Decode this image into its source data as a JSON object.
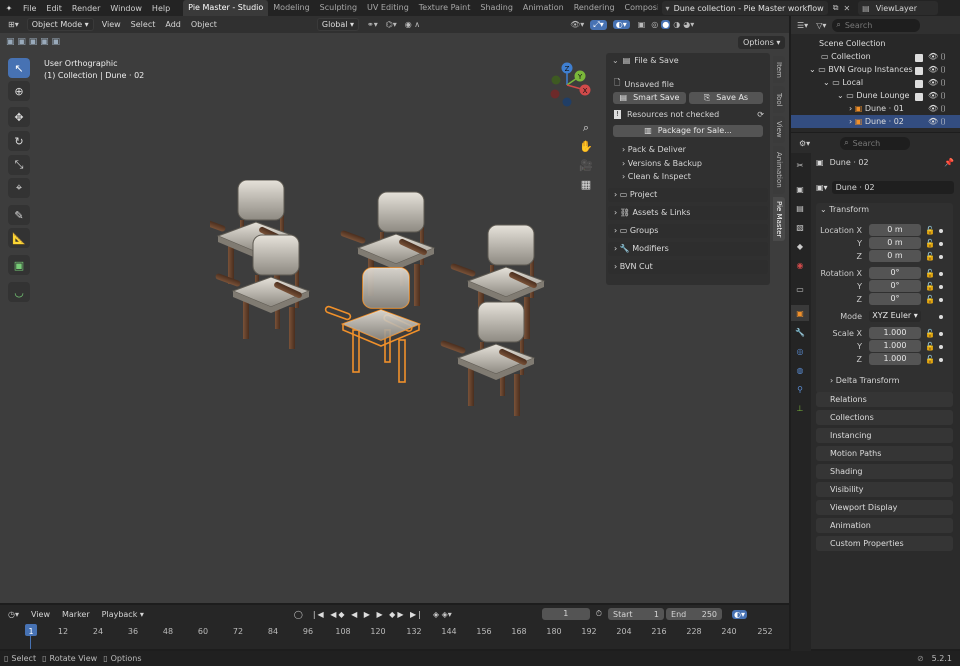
{
  "menu": [
    "File",
    "Edit",
    "Render",
    "Window",
    "Help"
  ],
  "workspaces": [
    {
      "label": "Pie Master - Studio",
      "active": true
    },
    {
      "label": "Modeling"
    },
    {
      "label": "Sculpting"
    },
    {
      "label": "UV Editing"
    },
    {
      "label": "Texture Paint"
    },
    {
      "label": "Shading"
    },
    {
      "label": "Animation"
    },
    {
      "label": "Rendering"
    },
    {
      "label": "Composi"
    }
  ],
  "scene_name": "Dune collection - Pie Master workflow",
  "view_layer": "ViewLayer",
  "outliner_search_placeholder": "Search",
  "viewport_header": {
    "mode": "Object Mode",
    "menus": [
      "View",
      "Select",
      "Add",
      "Object"
    ],
    "orientation": "Global",
    "options": "Options"
  },
  "viewport_overlay_text": {
    "line1": "User Orthographic",
    "line2": "(1) Collection | Dune · 02"
  },
  "gizmo": {
    "x": "X",
    "y": "Y",
    "z": "Z"
  },
  "npanel": {
    "file_save": "File & Save",
    "unsaved": "Unsaved file",
    "smart_save": "Smart Save",
    "save_as": "Save As",
    "resources": "Resources not checked",
    "package": "Package for Sale...",
    "sub": [
      "Pack & Deliver",
      "Versions & Backup",
      "Clean & Inspect"
    ],
    "sections": [
      "Project",
      "Assets & Links",
      "Groups",
      "Modifiers",
      "BVN Cut"
    ],
    "tabs": [
      "Item",
      "Tool",
      "View",
      "Animation",
      "Pie Master"
    ]
  },
  "outliner": [
    {
      "label": "Scene Collection"
    },
    {
      "label": "Collection"
    },
    {
      "label": "BVN Group Instances"
    },
    {
      "label": "Local"
    },
    {
      "label": "Dune Lounge"
    },
    {
      "label": "Dune · 01"
    },
    {
      "label": "Dune · 02",
      "selected": true
    }
  ],
  "properties": {
    "search_placeholder": "Search",
    "object_name": "Dune · 02",
    "data_name": "Dune · 02",
    "transform": "Transform",
    "location_label": "Location X",
    "location": [
      "0 m",
      "0 m",
      "0 m"
    ],
    "rotation_label": "Rotation X",
    "rotation": [
      "0°",
      "0°",
      "0°"
    ],
    "mode_label": "Mode",
    "mode": "XYZ Euler",
    "scale_label": "Scale X",
    "scale": [
      "1.000",
      "1.000",
      "1.000"
    ],
    "axis_y": "Y",
    "axis_z": "Z",
    "delta": "Delta Transform",
    "sections": [
      "Relations",
      "Collections",
      "Instancing",
      "Motion Paths",
      "Shading",
      "Visibility",
      "Viewport Display",
      "Animation",
      "Custom Properties"
    ]
  },
  "timeline": {
    "menus": [
      "View",
      "Marker",
      "Playback"
    ],
    "current": "1",
    "start_label": "Start",
    "start": "1",
    "end_label": "End",
    "end": "250",
    "ticks": [
      "1",
      "12",
      "24",
      "36",
      "48",
      "60",
      "72",
      "84",
      "96",
      "108",
      "120",
      "132",
      "144",
      "156",
      "168",
      "180",
      "192",
      "204",
      "216",
      "228",
      "240",
      "252"
    ]
  },
  "statusbar": {
    "select": "Select",
    "rotate": "Rotate View",
    "options": "Options",
    "version": "5.2.1"
  }
}
